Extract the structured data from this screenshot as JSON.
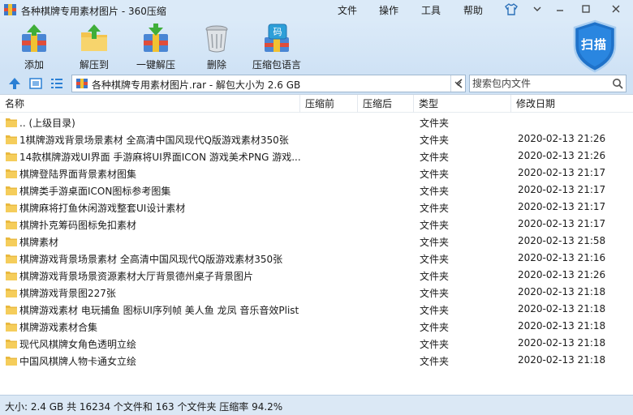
{
  "window": {
    "title": "各种棋牌专用素材图片 - 360压缩",
    "menu": [
      "文件",
      "操作",
      "工具",
      "帮助"
    ]
  },
  "toolbar": {
    "add": "添加",
    "extract_to": "解压到",
    "one_click_extract": "一键解压",
    "delete": "删除",
    "lang": "压缩包语言",
    "lang_badge": "码",
    "scan": "扫描"
  },
  "address": {
    "path": "各种棋牌专用素材图片.rar - 解包大小为 2.6 GB",
    "search_placeholder": "搜索包内文件"
  },
  "columns": {
    "name": "名称",
    "compressed": "压缩前",
    "after": "压缩后",
    "type": "类型",
    "modified": "修改日期"
  },
  "files": [
    {
      "name": ".. (上级目录)",
      "type": "文件夹",
      "date": ""
    },
    {
      "name": "1棋牌游戏背景场景素材 全高清中国风现代Q版游戏素材350张",
      "type": "文件夹",
      "date": "2020-02-13 21:26"
    },
    {
      "name": "14款棋牌游戏UI界面 手游麻将UI界面ICON 游戏美术PNG 游戏...",
      "type": "文件夹",
      "date": "2020-02-13 21:26"
    },
    {
      "name": "棋牌登陆界面背景素材图集",
      "type": "文件夹",
      "date": "2020-02-13 21:17"
    },
    {
      "name": "棋牌类手游桌面ICON图标参考图集",
      "type": "文件夹",
      "date": "2020-02-13 21:17"
    },
    {
      "name": "棋牌麻将打鱼休闲游戏整套UI设计素材",
      "type": "文件夹",
      "date": "2020-02-13 21:17"
    },
    {
      "name": "棋牌扑克筹码图标免扣素材",
      "type": "文件夹",
      "date": "2020-02-13 21:17"
    },
    {
      "name": "棋牌素材",
      "type": "文件夹",
      "date": "2020-02-13 21:58"
    },
    {
      "name": "棋牌游戏背景场景素材 全高清中国风现代Q版游戏素材350张",
      "type": "文件夹",
      "date": "2020-02-13 21:16"
    },
    {
      "name": "棋牌游戏背景场景资源素材大厅背景德州桌子背景图片",
      "type": "文件夹",
      "date": "2020-02-13 21:26"
    },
    {
      "name": "棋牌游戏背景图227张",
      "type": "文件夹",
      "date": "2020-02-13 21:18"
    },
    {
      "name": "棋牌游戏素材 电玩捕鱼 图标UI序列帧 美人鱼 龙凤 音乐音效Plist",
      "type": "文件夹",
      "date": "2020-02-13 21:18"
    },
    {
      "name": "棋牌游戏素材合集",
      "type": "文件夹",
      "date": "2020-02-13 21:18"
    },
    {
      "name": "现代风棋牌女角色透明立绘",
      "type": "文件夹",
      "date": "2020-02-13 21:18"
    },
    {
      "name": "中国风棋牌人物卡通女立绘",
      "type": "文件夹",
      "date": "2020-02-13 21:18"
    }
  ],
  "status": {
    "text": "大小: 2.4 GB 共 16234 个文件和 163 个文件夹 压缩率 94.2%"
  },
  "colors": {
    "folder": "#f5cd5b",
    "accent": "#2a7fd4",
    "scan_shield": "#1f72c9"
  }
}
